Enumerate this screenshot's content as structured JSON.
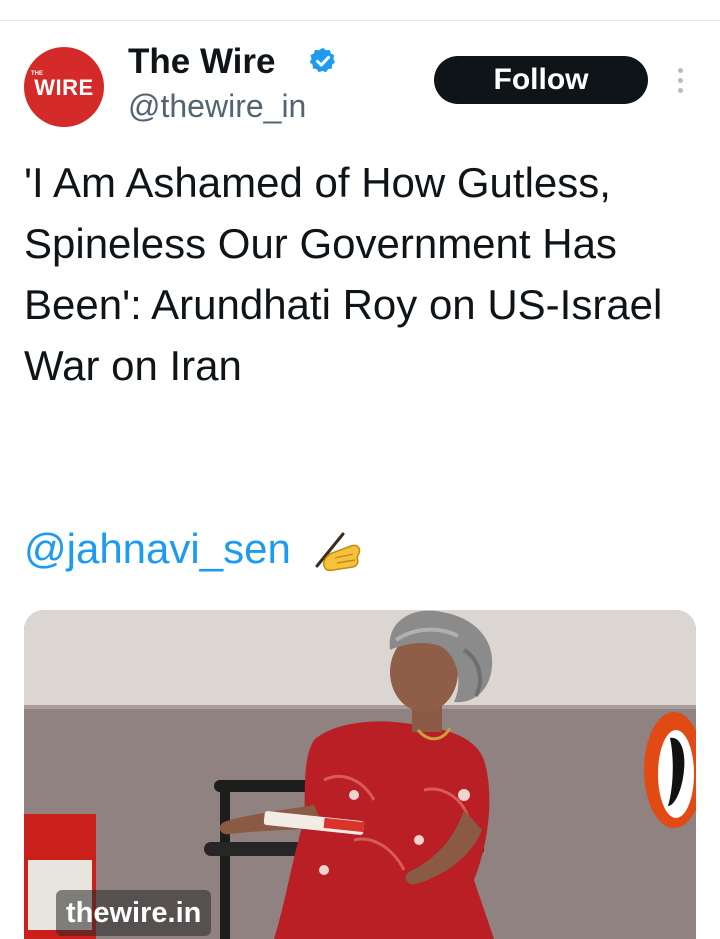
{
  "account": {
    "avatar_small_text": "THE",
    "avatar_text": "WIRE",
    "name": "The Wire",
    "handle": "@thewire_in",
    "verified": true,
    "verified_icon": "verified-badge-icon"
  },
  "actions": {
    "follow_label": "Follow",
    "more_icon": "more-vertical-icon"
  },
  "tweet": {
    "text": "'I Am Ashamed of How Gutless, Spineless Our Government Has Been': Arundhati Roy on US-Israel War on Iran",
    "mention": "@jahnavi_sen",
    "mention_emoji_icon": "writing-hand-icon"
  },
  "media": {
    "watermark": "thewire.in",
    "description_icon": "photo-image"
  },
  "colors": {
    "brand_red": "#d42a2a",
    "link_blue": "#1d9bf0",
    "text_primary": "#0f1419",
    "text_secondary": "#536471",
    "follow_bg": "#0f1419"
  }
}
